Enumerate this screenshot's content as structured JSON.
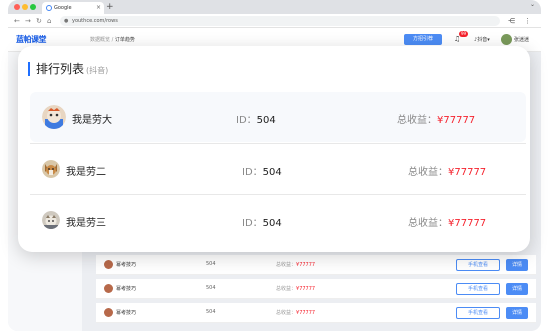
{
  "browser": {
    "tab_title": "Google",
    "url": "youthce.com/rows"
  },
  "app": {
    "logo_text": "蓝帕课堂",
    "breadcrumb": [
      "数据概览",
      "订单趋势"
    ],
    "promo_label": "方招引荐",
    "notification_count": "99",
    "platform_label": "抖音",
    "username": "张迷迷"
  },
  "ranking": {
    "title": "排行列表",
    "subtitle": "(抖音)",
    "id_label": "ID：",
    "revenue_label": "总收益：",
    "rows": [
      {
        "name": "我是劳大",
        "id": "504",
        "revenue": "¥77777"
      },
      {
        "name": "我是劳二",
        "id": "504",
        "revenue": "¥77777"
      },
      {
        "name": "我是劳三",
        "id": "504",
        "revenue": "¥77777"
      }
    ]
  },
  "background_table": {
    "rows": [
      {
        "name": "幂考技巧",
        "id": "504",
        "revenue_label": "总收益：",
        "revenue": "¥77777",
        "view_label": "手机查看",
        "detail_label": "详情"
      },
      {
        "name": "幂考技巧",
        "id": "504",
        "revenue_label": "总收益：",
        "revenue": "¥77777",
        "view_label": "手机查看",
        "detail_label": "详情"
      },
      {
        "name": "幂考技巧",
        "id": "504",
        "revenue_label": "总收益：",
        "revenue": "¥77777",
        "view_label": "手机查看",
        "detail_label": "详情"
      }
    ]
  },
  "colors": {
    "accent": "#1f6fff",
    "revenue": "#f5222d"
  }
}
